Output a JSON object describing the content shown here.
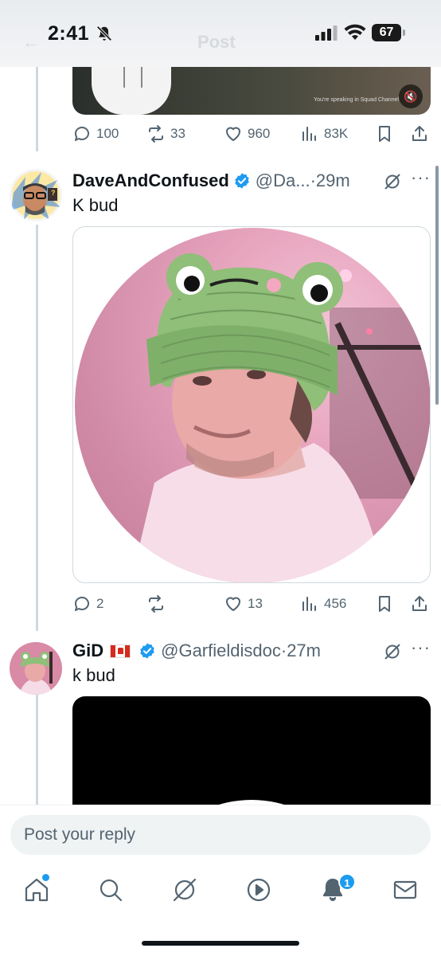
{
  "status_bar": {
    "time": "2:41",
    "battery": "67",
    "title_ghost": "Post"
  },
  "prev_tweet": {
    "media_caption": "You're speaking in Squad Channel",
    "stats": {
      "replies": "100",
      "reposts": "33",
      "likes": "960",
      "views": "83K"
    }
  },
  "tweets": [
    {
      "display_name": "DaveAndConfused",
      "handle": "@Da...",
      "separator": "·",
      "time": "29m",
      "text": "K bud",
      "stats": {
        "replies": "2",
        "reposts": "",
        "likes": "13",
        "views": "456"
      }
    },
    {
      "display_name": "GiD",
      "handle": "@Garfieldisdoc",
      "separator": "·",
      "time": "27m",
      "text": "k bud"
    }
  ],
  "reply": {
    "placeholder": "Post your reply"
  },
  "tab_bar": {
    "items": [
      "home-icon",
      "search-icon",
      "grok-icon",
      "video-icon",
      "notifications-icon",
      "messages-icon"
    ],
    "notification_count": "1"
  },
  "colors": {
    "accent": "#1d9bf0",
    "text": "#0f1419",
    "muted": "#536471"
  }
}
